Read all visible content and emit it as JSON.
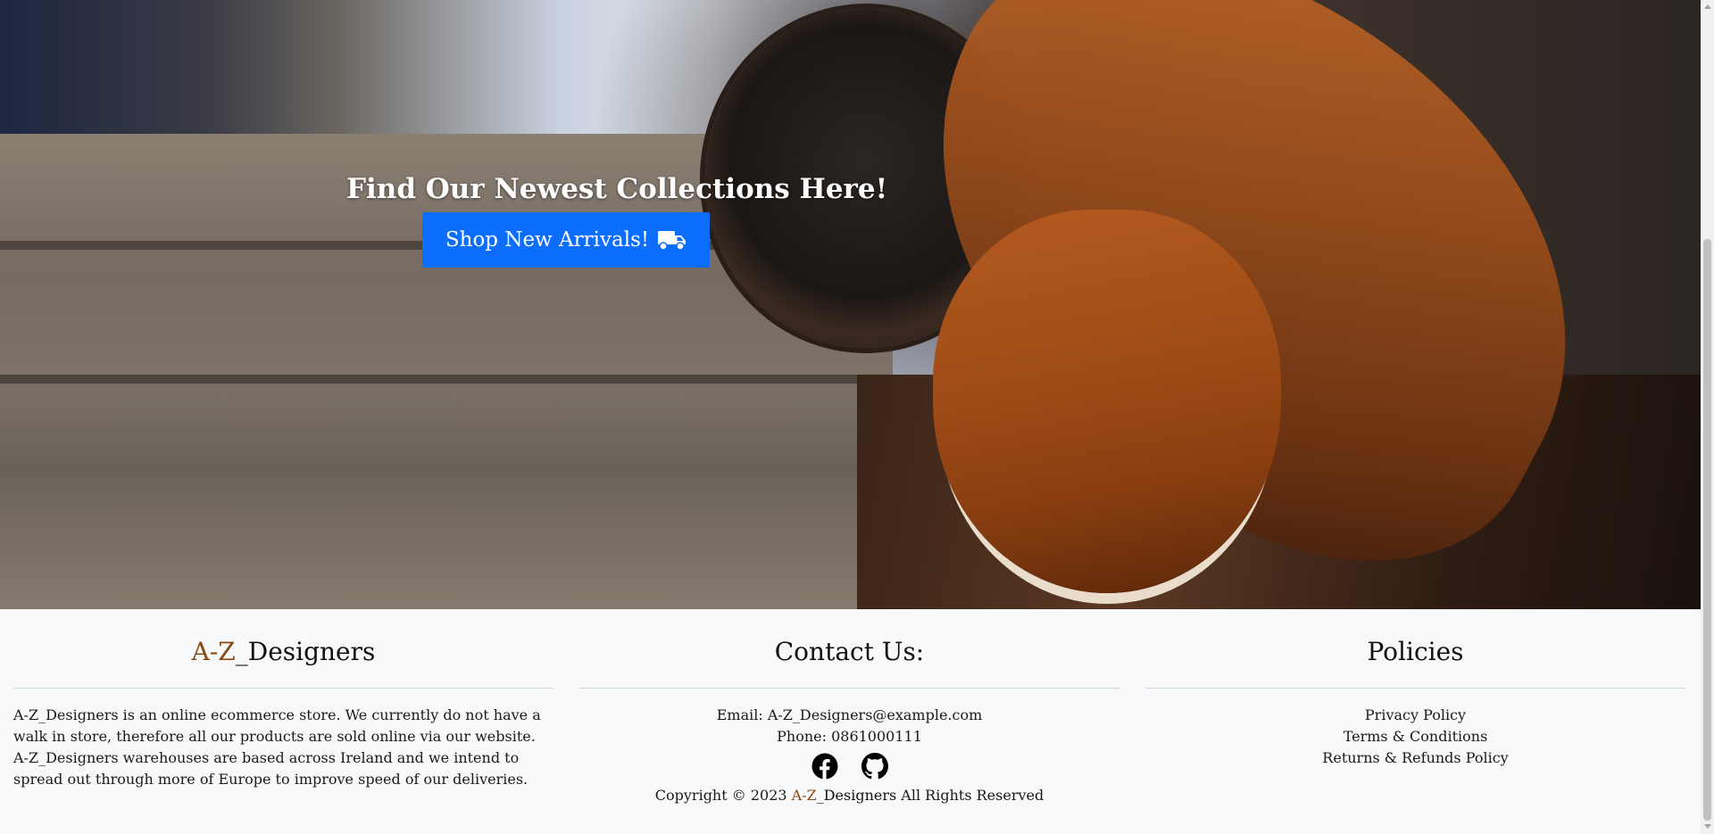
{
  "hero": {
    "heading": "Find Our Newest Collections Here!",
    "button_label": "Shop New Arrivals!",
    "button_icon": "truck-icon",
    "button_color": "#0d6efd"
  },
  "footer": {
    "brand": {
      "prefix": "A-Z",
      "suffix": "_Designers",
      "accent_color": "#8b4a12"
    },
    "about_text": "A-Z_Designers is an online ecommerce store. We currently do not have a walk in store, therefore all our products are sold online via our website. A-Z_Designers warehouses are based across Ireland and we intend to spread out through more of Europe to improve speed of our deliveries.",
    "contact": {
      "title": "Contact Us:",
      "email": "Email: A-Z_Designers@example.com",
      "phone": "Phone: 0861000111",
      "social_icons": [
        "facebook-icon",
        "github-icon"
      ]
    },
    "copyright": {
      "before": "Copyright © 2023 ",
      "after": " All Rights Reserved"
    },
    "policies": {
      "title": "Policies",
      "links": [
        "Privacy Policy",
        "Terms & Conditions",
        "Returns & Refunds Policy"
      ]
    }
  }
}
